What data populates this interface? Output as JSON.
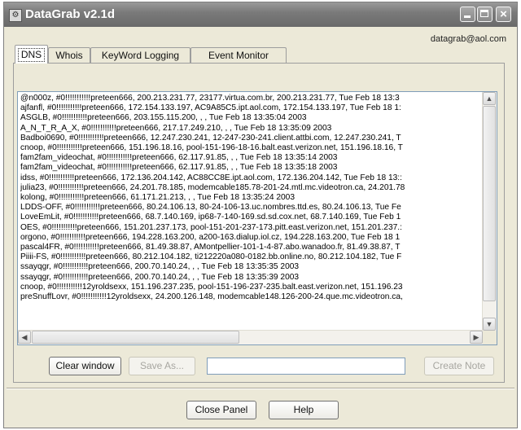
{
  "window": {
    "title": "DataGrab v2.1d",
    "controls": {
      "minimize": "minimize-icon",
      "maximize": "maximize-icon",
      "close": "close-icon"
    }
  },
  "header": {
    "email": "datagrab@aol.com"
  },
  "tabs": [
    {
      "label": "DNS",
      "active": true
    },
    {
      "label": "Whois",
      "active": false
    },
    {
      "label": "KeyWord Logging",
      "active": false
    },
    {
      "label": "Event Monitor",
      "active": false
    }
  ],
  "log": {
    "lines": [
      "@n000z, #0!!!!!!!!!!!preteen666, 200.213.231.77, 23177.virtua.com.br, 200.213.231.77, Tue Feb 18 13:3",
      "ajfanfl, #0!!!!!!!!!!!preteen666, 172.154.133.197, AC9A85C5.ipt.aol.com, 172.154.133.197, Tue Feb 18 1:",
      "ASGLB, #0!!!!!!!!!!!preteen666, 203.155.115.200, , , Tue Feb 18 13:35:04 2003",
      "A_N_T_R_A_X, #0!!!!!!!!!!!preteen666, 217.17.249.210, , , Tue Feb 18 13:35:09 2003",
      "Badboi0690, #0!!!!!!!!!!!preteen666, 12.247.230.241, 12-247-230-241.client.attbi.com, 12.247.230.241, T",
      "cnoop, #0!!!!!!!!!!!preteen666, 151.196.18.16, pool-151-196-18-16.balt.east.verizon.net, 151.196.18.16, T",
      "fam2fam_videochat, #0!!!!!!!!!!!preteen666, 62.117.91.85, , , Tue Feb 18 13:35:14 2003",
      "fam2fam_videochat, #0!!!!!!!!!!!preteen666, 62.117.91.85, , , Tue Feb 18 13:35:18 2003",
      "idss, #0!!!!!!!!!!!preteen666, 172.136.204.142, AC88CC8E.ipt.aol.com, 172.136.204.142, Tue Feb 18 13::",
      "julia23, #0!!!!!!!!!!!preteen666, 24.201.78.185, modemcable185.78-201-24.mtl.mc.videotron.ca, 24.201.78",
      "kolong, #0!!!!!!!!!!!preteen666, 61.171.21.213, , , Tue Feb 18 13:35:24 2003",
      "LDDS-OFF, #0!!!!!!!!!!!preteen666, 80.24.106.13, 80-24-106-13.uc.nombres.ttd.es, 80.24.106.13, Tue Fe",
      "LoveEmLit, #0!!!!!!!!!!!preteen666, 68.7.140.169, ip68-7-140-169.sd.sd.cox.net, 68.7.140.169, Tue Feb 1",
      "OES, #0!!!!!!!!!!!preteen666, 151.201.237.173, pool-151-201-237-173.pitt.east.verizon.net, 151.201.237.:",
      "orgono, #0!!!!!!!!!!!preteen666, 194.228.163.200, a200-163.dialup.iol.cz, 194.228.163.200, Tue Feb 18 1",
      "pascal4FR, #0!!!!!!!!!!!preteen666, 81.49.38.87, AMontpellier-101-1-4-87.abo.wanadoo.fr, 81.49.38.87, T",
      "Piiii-FS, #0!!!!!!!!!!!preteen666, 80.212.104.182, ti212220a080-0182.bb.online.no, 80.212.104.182, Tue F",
      "ssayqgr, #0!!!!!!!!!!!preteen666, 200.70.140.24, , , Tue Feb 18 13:35:35 2003",
      "ssayqgr, #0!!!!!!!!!!!preteen666, 200.70.140.24, , , Tue Feb 18 13:35:39 2003",
      "cnoop, #0!!!!!!!!!!!12yroldsexx, 151.196.237.235, pool-151-196-237-235.balt.east.verizon.net, 151.196.23",
      "preSnuffLovr, #0!!!!!!!!!!!12yroldsexx, 24.200.126.148, modemcable148.126-200-24.que.mc.videotron.ca,"
    ]
  },
  "buttons": {
    "clear": "Clear window",
    "save_as": "Save As...",
    "create_note": "Create Note",
    "close_panel": "Close Panel",
    "help": "Help"
  },
  "note_input": {
    "value": ""
  }
}
